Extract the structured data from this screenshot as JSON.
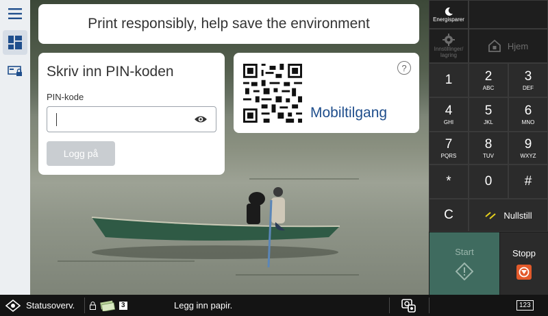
{
  "banner": {
    "text": "Print responsibly, help save the environment"
  },
  "pin": {
    "title": "Skriv inn PIN-koden",
    "field_label": "PIN-kode",
    "value": "",
    "login_label": "Logg på"
  },
  "mobile": {
    "label": "Mobiltilgang",
    "help": "?"
  },
  "keypad": {
    "energy_label": "Energisparer",
    "settings_label": "Innstillinger/ lagring",
    "home_label": "Hjem",
    "keys": [
      {
        "n": "1",
        "l": ""
      },
      {
        "n": "2",
        "l": "ABC"
      },
      {
        "n": "3",
        "l": "DEF"
      },
      {
        "n": "4",
        "l": "GHI"
      },
      {
        "n": "5",
        "l": "JKL"
      },
      {
        "n": "6",
        "l": "MNO"
      },
      {
        "n": "7",
        "l": "PQRS"
      },
      {
        "n": "8",
        "l": "TUV"
      },
      {
        "n": "9",
        "l": "WXYZ"
      },
      {
        "n": "*",
        "l": ""
      },
      {
        "n": "0",
        "l": ""
      },
      {
        "n": "#",
        "l": ""
      }
    ],
    "clear_label": "C",
    "reset_label": "Nullstill",
    "start_label": "Start",
    "stop_label": "Stopp"
  },
  "statusbar": {
    "status_label": "Statusoverv.",
    "job_count": "3",
    "message": "Legg inn papir.",
    "keyboard_label": "123"
  },
  "colors": {
    "accent": "#1f4e8c",
    "start": "#3f6b5f",
    "stop": "#e35a2b"
  }
}
